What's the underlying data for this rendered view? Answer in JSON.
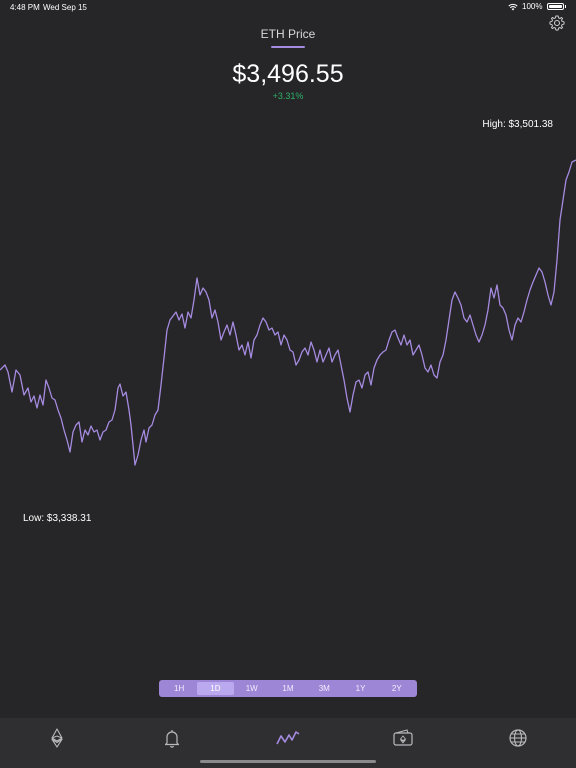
{
  "status": {
    "time": "4:48 PM",
    "date": "Wed Sep 15",
    "battery": "100%"
  },
  "header": {
    "title": "ETH Price",
    "price": "$3,496.55",
    "change": "+3.31%"
  },
  "chart": {
    "high_label": "High: $3,501.38",
    "low_label": "Low: $3,338.31"
  },
  "ranges": [
    {
      "label": "1H",
      "active": false
    },
    {
      "label": "1D",
      "active": true
    },
    {
      "label": "1W",
      "active": false
    },
    {
      "label": "1M",
      "active": false
    },
    {
      "label": "3M",
      "active": false
    },
    {
      "label": "1Y",
      "active": false
    },
    {
      "label": "2Y",
      "active": false
    }
  ],
  "tabs": [
    {
      "name": "ethereum-icon",
      "active": false
    },
    {
      "name": "bell-icon",
      "active": false
    },
    {
      "name": "chart-icon",
      "active": true
    },
    {
      "name": "wallet-icon",
      "active": false
    },
    {
      "name": "globe-icon",
      "active": false
    }
  ],
  "colors": {
    "accent": "#a58be0",
    "positive": "#2fb36a",
    "background": "#262527",
    "tabbar": "#2f2e31"
  }
}
